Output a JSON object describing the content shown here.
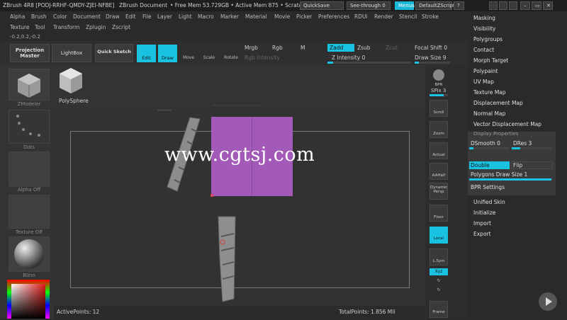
{
  "titlebar": {
    "app": "ZBrush 4R8 [PODJ-RRHF-QMDY-ZJEI-NFBE]",
    "document": "ZBrush Document",
    "free_mem": "• Free Mem 53.729GB • Active Mem 875 • Scratch Disk",
    "quicksave": "QuickSave",
    "see_through": "See-through  0",
    "menus": "Menus",
    "default_zscript": "DefaultZScript"
  },
  "menubar": {
    "row1": [
      "Alpha",
      "Brush",
      "Color",
      "Document",
      "Draw",
      "Edit",
      "File",
      "Layer",
      "Light",
      "Macro",
      "Marker",
      "Material",
      "Movie",
      "Picker",
      "Preferences",
      "RDUi",
      "Render",
      "Stencil",
      "Stroke"
    ],
    "row2": [
      "Texture",
      "Tool",
      "Transform",
      "Zplugin",
      "Zscript"
    ]
  },
  "coords": "-0.2,0.2,-0.2",
  "toolbar": {
    "projection_master": "Projection Master",
    "lightbox": "LightBox",
    "quick_sketch": "Quick Sketch",
    "edit": "Edit",
    "draw": "Draw",
    "move": "Move",
    "scale": "Scale",
    "rotate": "Rotate",
    "mrgb": "Mrgb",
    "rgb": "Rgb",
    "m": "M",
    "zadd": "Zadd",
    "zsub": "Zsub",
    "zcut": "Zcut",
    "rgb_intensity": "Rgb Intensity",
    "z_intensity": "Z Intensity 0",
    "focal_shift": "Focal Shift 0",
    "draw_size": "Draw Size 9"
  },
  "left_panel": {
    "zmodeler": "ZModeler",
    "dots": "Dots",
    "alpha": "Alpha Off",
    "texture": "Texture Off",
    "material": "Blinn"
  },
  "tool_thumb": {
    "label": "PolySphere"
  },
  "right_strip": [
    "BPR",
    "SPix 3",
    "Scroll",
    "Zoom",
    "Actual",
    "AAHalf",
    "Dynamic Persp",
    "Floor",
    "Local",
    "L.Sym",
    "Xyz",
    "Frame"
  ],
  "right_panel": {
    "items_top": [
      "Masking",
      "Visibility",
      "Polygroups",
      "Contact",
      "Morph Target",
      "Polypaint",
      "UV Map",
      "Texture Map",
      "Displacement Map",
      "Normal Map",
      "Vector Displacement Map"
    ],
    "display_properties": {
      "title": "Display Properties",
      "dsmooth": "DSmooth 0",
      "dres": "DRes 3",
      "double": "Double",
      "flip": "Flip",
      "pds": "Polygons Draw Size 1",
      "bpr": "BPR Settings"
    },
    "items_bottom": [
      "Unified Skin",
      "Initialize",
      "Import",
      "Export"
    ]
  },
  "status": {
    "active_points": "ActivePoints: 12",
    "total_points": "TotalPoints: 1.856 Mil"
  },
  "watermark": "www.cgtsj.com",
  "colors": {
    "accent": "#18c2e0",
    "purple": "#a259b8",
    "bg": "#2b2b2b"
  }
}
